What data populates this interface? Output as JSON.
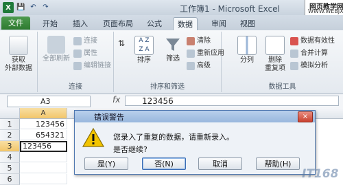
{
  "titlebar": {
    "title": "工作簿1 - Microsoft Excel",
    "excel_logo": "X",
    "watermark_line1": "网页教学网",
    "watermark_line2": "WWW.WEBJX.COM"
  },
  "qat_icons": [
    "save-icon",
    "undo-icon",
    "redo-icon"
  ],
  "tabs": [
    {
      "label": "文件"
    },
    {
      "label": "开始"
    },
    {
      "label": "插入"
    },
    {
      "label": "页面布局"
    },
    {
      "label": "公式"
    },
    {
      "label": "数据"
    },
    {
      "label": "审阅"
    },
    {
      "label": "视图"
    }
  ],
  "active_tab": "数据",
  "ribbon": {
    "get_external": {
      "line1": "获取",
      "line2": "外部数据"
    },
    "connections": {
      "label": "连接",
      "refresh_all": "全部刷新",
      "items": [
        "连接",
        "属性",
        "编辑链接"
      ]
    },
    "sort_filter": {
      "label": "排序和筛选",
      "sort": "排序",
      "filter": "筛选",
      "items": [
        "清除",
        "重新应用",
        "高级"
      ]
    },
    "data_tools": {
      "label": "数据工具",
      "split": "分列",
      "remove_dup_line1": "删除",
      "remove_dup_line2": "重复项",
      "items": [
        "数据有效性",
        "合并计算",
        "模拟分析"
      ]
    }
  },
  "formula_bar": {
    "name_box": "A3",
    "fx": "fx",
    "value": "123456"
  },
  "grid": {
    "column_header": "A",
    "rows": [
      "1",
      "2",
      "3",
      "4",
      "5",
      "6"
    ],
    "cells": {
      "a1": "123456",
      "a2": "654321",
      "a3": "123456"
    }
  },
  "dialog": {
    "title": "错误警告",
    "close": "×",
    "message": "您录入了重复的数据，请重新录入。",
    "question": "是否继续?",
    "buttons": [
      "是(Y)",
      "否(N)",
      "取消",
      "帮助(H)"
    ]
  },
  "watermark_bottom": "IT168",
  "colors": {
    "file_tab": "#2e7a30",
    "dialog_title": "#98b7dd",
    "close": "#c8412f",
    "warning": "#f2c400"
  }
}
